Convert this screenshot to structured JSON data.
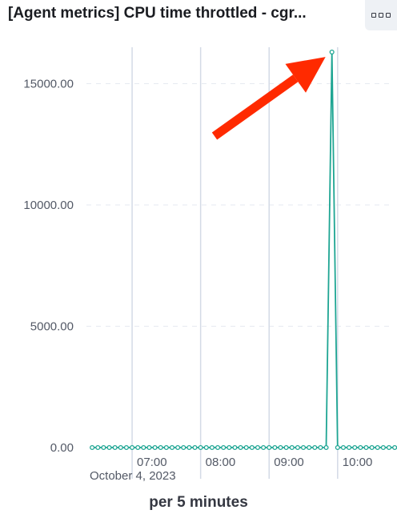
{
  "panel": {
    "title": "[Agent metrics] CPU time throttled - cgr...",
    "menu_icon": "options-icon"
  },
  "colors": {
    "series": "#1ea593",
    "arrow": "#ff2a00",
    "grid": "#d3dae6",
    "text": "#535966"
  },
  "annotation": {
    "type": "red-arrow",
    "points_to": "spike"
  },
  "chart_data": {
    "type": "line",
    "title": "[Agent metrics] CPU time throttled - cgr...",
    "xlabel": "per 5 minutes",
    "ylabel": "",
    "x_date_label": "October 4, 2023",
    "x_start": "06:25",
    "x_step_minutes": 5,
    "xlim": [
      "06:20",
      "10:45"
    ],
    "ylim": [
      0,
      16500
    ],
    "yticks": [
      {
        "value": 0,
        "label": "0.00"
      },
      {
        "value": 5000,
        "label": "5000.00"
      },
      {
        "value": 10000,
        "label": "10000.00"
      },
      {
        "value": 15000,
        "label": "15000.00"
      }
    ],
    "xticks": [
      {
        "time": "07:00",
        "label": "07:00"
      },
      {
        "time": "08:00",
        "label": "08:00"
      },
      {
        "time": "09:00",
        "label": "09:00"
      },
      {
        "time": "10:00",
        "label": "10:00"
      }
    ],
    "grid": true,
    "series": [
      {
        "values": [
          0,
          0,
          0,
          0,
          0,
          0,
          0,
          0,
          0,
          0,
          0,
          0,
          0,
          0,
          0,
          0,
          0,
          0,
          0,
          0,
          0,
          0,
          0,
          0,
          0,
          0,
          0,
          0,
          0,
          0,
          0,
          0,
          0,
          0,
          0,
          0,
          0,
          0,
          0,
          0,
          0,
          0,
          16300,
          0,
          0,
          0,
          0,
          0,
          0,
          0,
          0,
          0,
          0,
          0
        ]
      }
    ]
  }
}
